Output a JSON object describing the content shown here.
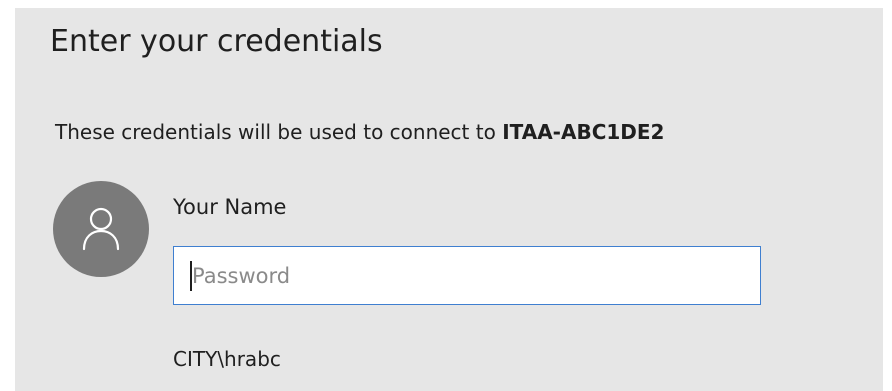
{
  "dialog": {
    "title": "Enter your credentials",
    "description_prefix": "These credentials will be used to connect to ",
    "host": "ITAA-ABC1DE2",
    "user": {
      "avatar_icon": "person-icon",
      "display_name": "Your Name",
      "account": "CITY\\hrabc"
    },
    "password_field": {
      "placeholder": "Password",
      "value": ""
    }
  },
  "colors": {
    "dialog_background": "#e6e6e6",
    "avatar_background": "#7a7a7a",
    "input_border_focus": "#3f7fd0",
    "text": "#1f1f1f",
    "placeholder": "#8a8a8a"
  }
}
